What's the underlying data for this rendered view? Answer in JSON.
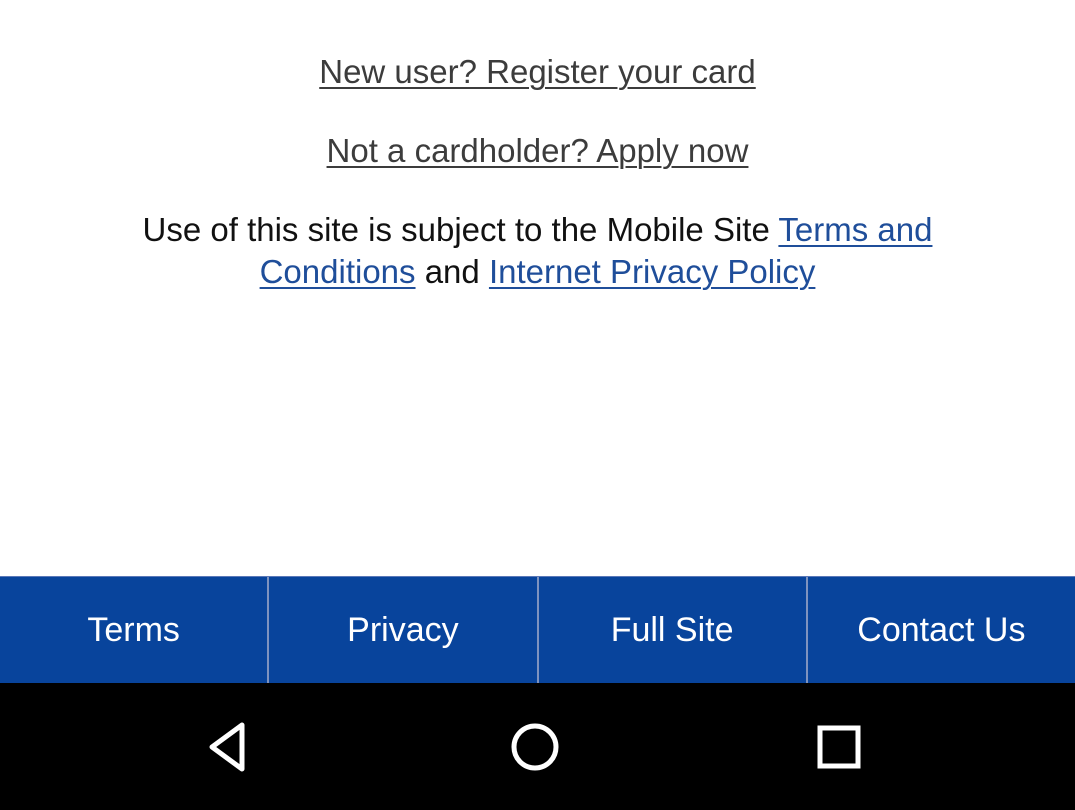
{
  "links": {
    "register_text": "New user? Register your card",
    "apply_text": "Not a cardholder? Apply now"
  },
  "legal": {
    "prefix": "Use of this site is subject to the Mobile Site ",
    "terms_link": "Terms and Conditions",
    "middle": " and ",
    "privacy_link": "Internet Privacy Policy"
  },
  "footer": {
    "items": [
      {
        "label": "Terms"
      },
      {
        "label": "Privacy"
      },
      {
        "label": "Full Site"
      },
      {
        "label": "Contact Us"
      }
    ]
  },
  "system_nav": {
    "back_icon": "back-triangle-icon",
    "home_icon": "home-circle-icon",
    "recents_icon": "recents-square-icon"
  },
  "colors": {
    "footer_bg": "#08449c",
    "link_blue": "#1f4e9a",
    "nav_bar_bg": "#000000"
  }
}
